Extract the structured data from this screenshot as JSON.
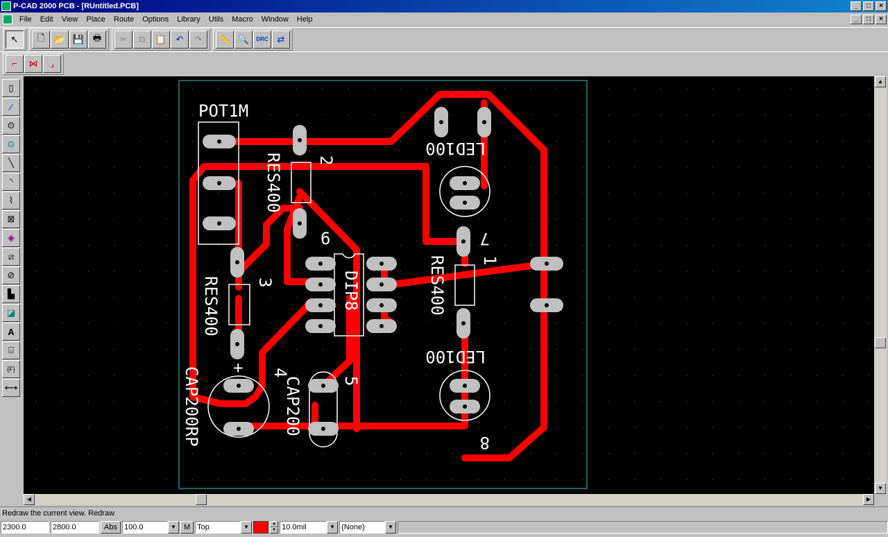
{
  "window": {
    "title": "P-CAD 2000 PCB - [RUntitled.PCB]",
    "min": "_",
    "max": "□",
    "close": "×"
  },
  "menu": [
    "File",
    "Edit",
    "View",
    "Place",
    "Route",
    "Options",
    "Library",
    "Utils",
    "Macro",
    "Window",
    "Help"
  ],
  "toolbar": {
    "select": "↖",
    "new": "🗋",
    "open": "📂",
    "save": "💾",
    "print": "🖶",
    "cut": "✂",
    "copy": "⧉",
    "paste": "📋",
    "undo": "↶",
    "redo": "↷",
    "measure": "📏",
    "zoom": "🔍",
    "drc": "DRC",
    "netlist": "⇄"
  },
  "toolbar2": {
    "route_manual": "⌐",
    "route_interactive": "⋈",
    "route_miter": "⌟"
  },
  "left_tools": [
    "▯",
    "∕",
    "⊙",
    "⊙",
    "╲",
    "◝",
    "⌇",
    "⊠",
    "◈",
    "⧄",
    "⊘",
    "▙",
    "◪",
    "A",
    "⌸",
    "{F}",
    "⟷"
  ],
  "board": {
    "labels": {
      "pot": "POT1M",
      "res_top": "RES400",
      "res_left": "RES400",
      "res_right": "RES400",
      "led_top": "LED100",
      "led_bottom": "LED100",
      "dip": "DIP8",
      "cap": "CAP200",
      "cap_rp": "CAP200RP",
      "plus": "+",
      "n2": "2",
      "n3": "3",
      "n4": "4",
      "n5": "5",
      "n6": "6",
      "n7": "7",
      "n8": "8",
      "n1": "1"
    },
    "colors": {
      "trace": "#ff0000",
      "pad": "#c0c0c0",
      "silk": "#ffffff",
      "outline": "#40c0c0",
      "grid": "#808080",
      "background": "#000000"
    }
  },
  "status": {
    "message": "Redraw the current view. Redraw",
    "x": "2300.0",
    "y": "2800.0",
    "abs": "Abs",
    "grid": "100.0",
    "m": "M",
    "layer": "Top",
    "width": "10.0mil",
    "style": "(None)"
  }
}
